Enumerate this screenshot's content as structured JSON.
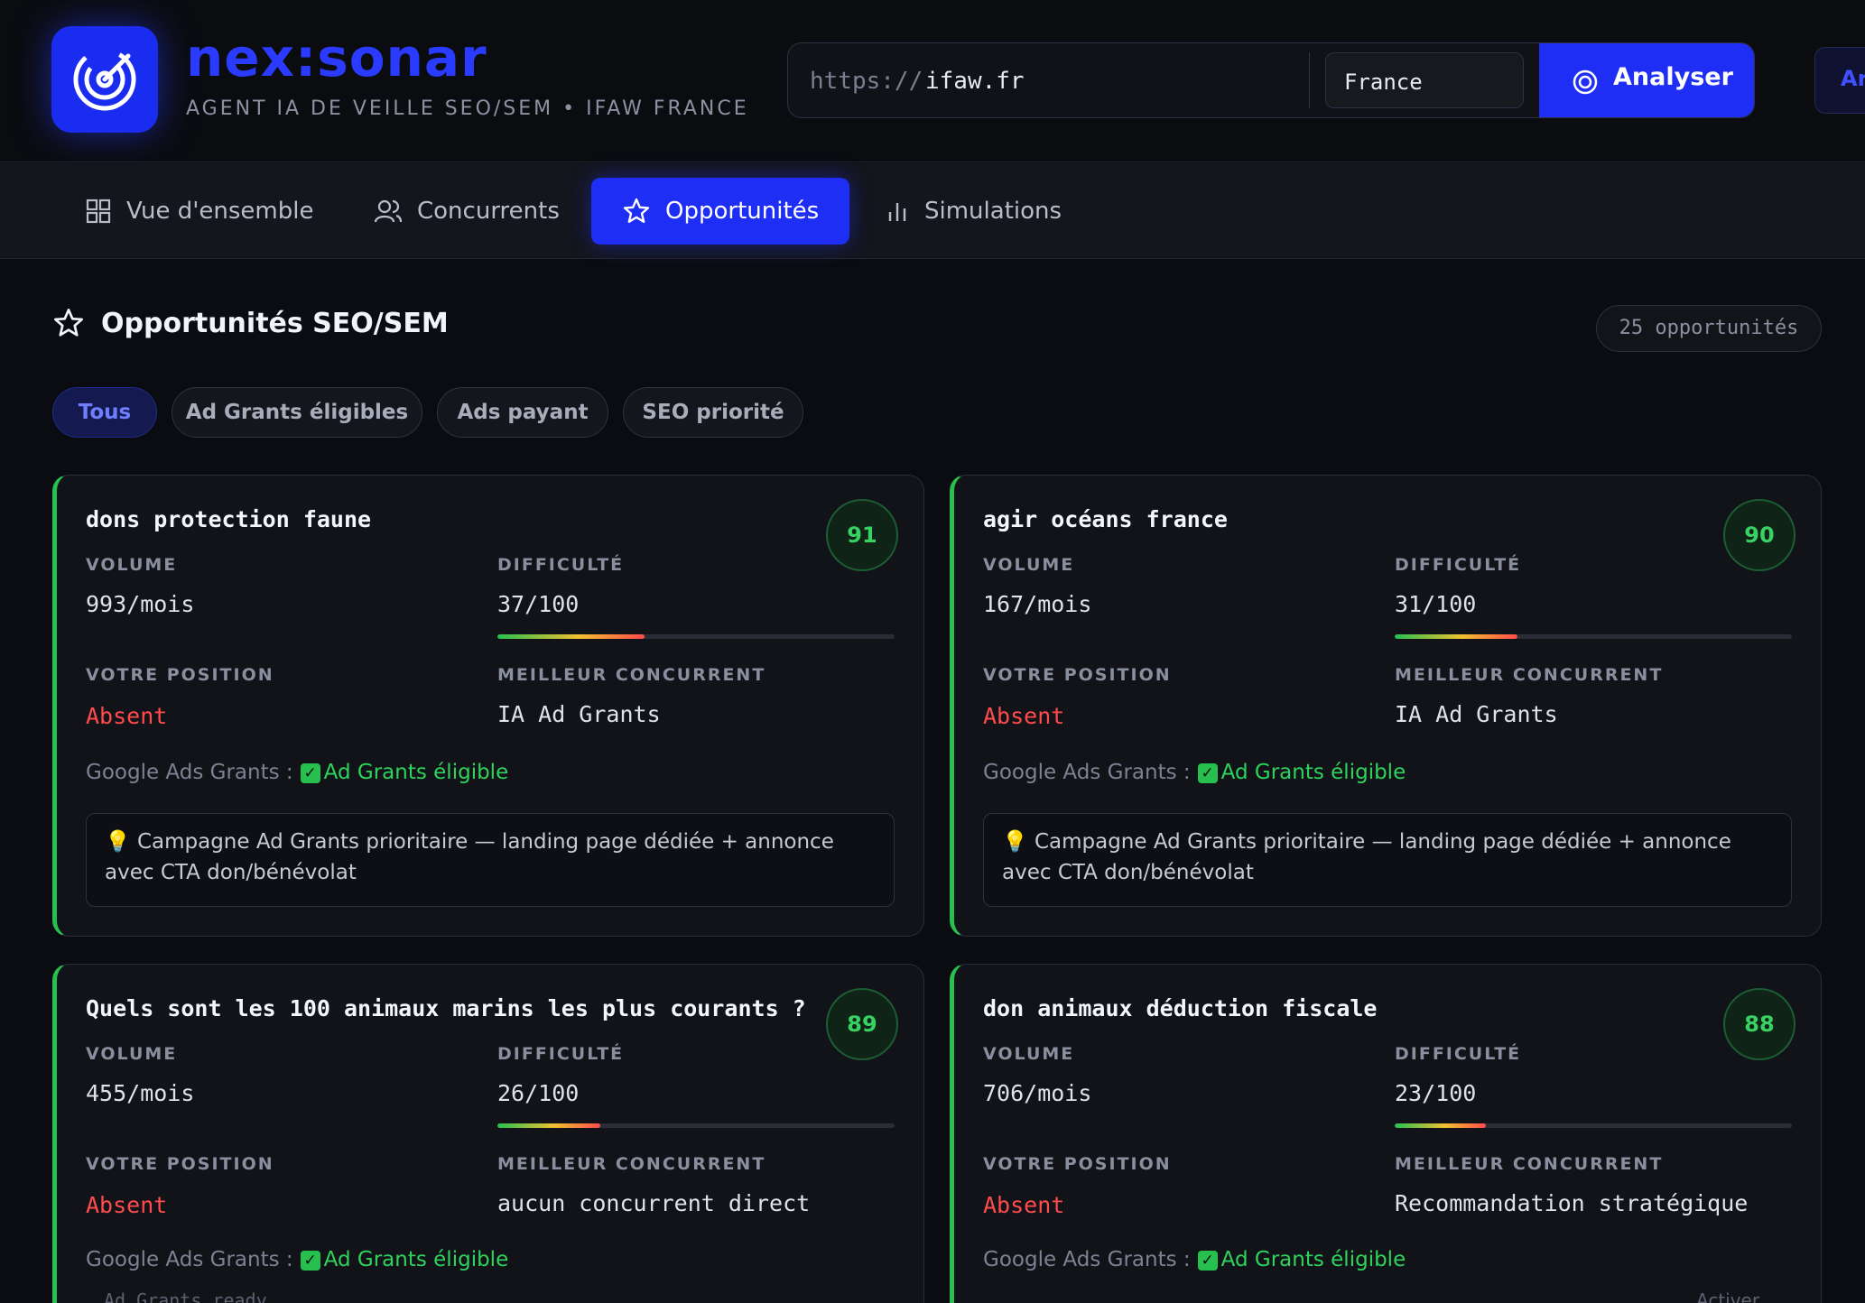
{
  "header": {
    "brand": "nex:sonar",
    "tagline": "AGENT IA DE VEILLE SEO/SEM • IFAW FRANCE",
    "url_prefix": "https://",
    "url_value": "ifaw.fr",
    "country": "France",
    "analyze_label": "Analyser",
    "side_button_label": "Ar"
  },
  "nav": {
    "tabs": [
      {
        "label": "Vue d'ensemble",
        "icon": "grid-icon"
      },
      {
        "label": "Concurrents",
        "icon": "users-icon"
      },
      {
        "label": "Opportunités",
        "icon": "star-icon",
        "active": true
      },
      {
        "label": "Simulations",
        "icon": "bar-chart-icon"
      }
    ]
  },
  "section": {
    "title": "Opportunités SEO/SEM",
    "count": "25 opportunités",
    "filters": [
      {
        "label": "Tous",
        "active": true
      },
      {
        "label": "Ad Grants éligibles"
      },
      {
        "label": "Ads payant"
      },
      {
        "label": "SEO priorité"
      }
    ]
  },
  "labels": {
    "volume": "VOLUME",
    "difficulty": "DIFFICULTÉ",
    "position": "VOTRE POSITION",
    "competitor": "MEILLEUR CONCURRENT",
    "grants_prefix": "Google Ads Grants :",
    "grants_status": "Ad Grants éligible"
  },
  "cards": [
    {
      "keyword": "dons protection faune",
      "score": "91",
      "volume": "993/mois",
      "difficulty": "37/100",
      "difficulty_pct": 37,
      "position": "Absent",
      "competitor": "IA Ad Grants",
      "tip": "💡 Campagne Ad Grants prioritaire — landing page dédiée + annonce avec CTA don/bénévolat"
    },
    {
      "keyword": "agir océans france",
      "score": "90",
      "volume": "167/mois",
      "difficulty": "31/100",
      "difficulty_pct": 31,
      "position": "Absent",
      "competitor": "IA Ad Grants",
      "tip": "💡 Campagne Ad Grants prioritaire — landing page dédiée + annonce avec CTA don/bénévolat"
    },
    {
      "keyword": "Quels sont les 100 animaux marins les plus courants ?",
      "score": "89",
      "volume": "455/mois",
      "difficulty": "26/100",
      "difficulty_pct": 26,
      "position": "Absent",
      "competitor": "aucun concurrent direct",
      "footer_text": "Ad Grants ready"
    },
    {
      "keyword": "don animaux déduction fiscale",
      "score": "88",
      "volume": "706/mois",
      "difficulty": "23/100",
      "difficulty_pct": 23,
      "position": "Absent",
      "competitor": "Recommandation stratégique",
      "footer_text": "Activer"
    }
  ],
  "colors": {
    "accent": "#1e2ef5",
    "brand": "#2a3bff",
    "success": "#27c04f",
    "danger": "#ff4b4b",
    "background": "#0b0c11"
  }
}
